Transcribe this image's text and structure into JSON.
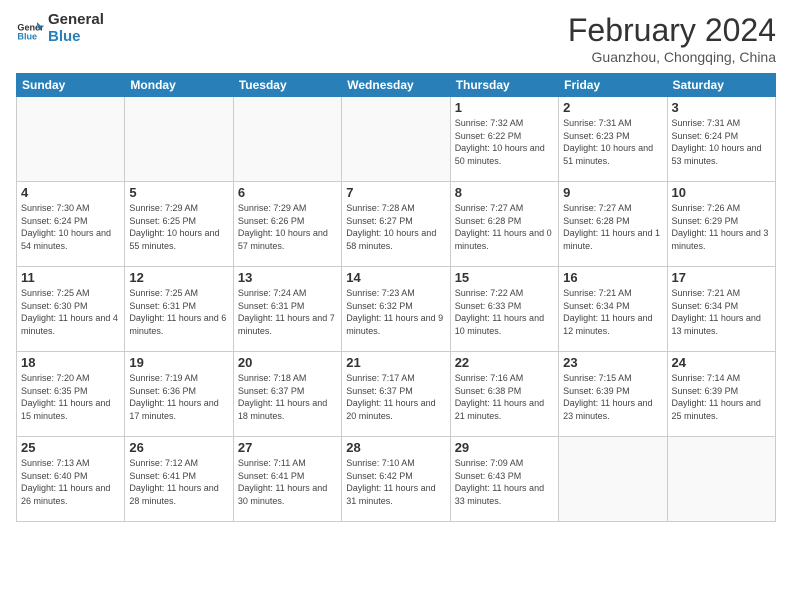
{
  "logo": {
    "line1": "General",
    "line2": "Blue"
  },
  "title": "February 2024",
  "subtitle": "Guanzhou, Chongqing, China",
  "days_header": [
    "Sunday",
    "Monday",
    "Tuesday",
    "Wednesday",
    "Thursday",
    "Friday",
    "Saturday"
  ],
  "weeks": [
    [
      {
        "num": "",
        "info": ""
      },
      {
        "num": "",
        "info": ""
      },
      {
        "num": "",
        "info": ""
      },
      {
        "num": "",
        "info": ""
      },
      {
        "num": "1",
        "info": "Sunrise: 7:32 AM\nSunset: 6:22 PM\nDaylight: 10 hours\nand 50 minutes."
      },
      {
        "num": "2",
        "info": "Sunrise: 7:31 AM\nSunset: 6:23 PM\nDaylight: 10 hours\nand 51 minutes."
      },
      {
        "num": "3",
        "info": "Sunrise: 7:31 AM\nSunset: 6:24 PM\nDaylight: 10 hours\nand 53 minutes."
      }
    ],
    [
      {
        "num": "4",
        "info": "Sunrise: 7:30 AM\nSunset: 6:24 PM\nDaylight: 10 hours\nand 54 minutes."
      },
      {
        "num": "5",
        "info": "Sunrise: 7:29 AM\nSunset: 6:25 PM\nDaylight: 10 hours\nand 55 minutes."
      },
      {
        "num": "6",
        "info": "Sunrise: 7:29 AM\nSunset: 6:26 PM\nDaylight: 10 hours\nand 57 minutes."
      },
      {
        "num": "7",
        "info": "Sunrise: 7:28 AM\nSunset: 6:27 PM\nDaylight: 10 hours\nand 58 minutes."
      },
      {
        "num": "8",
        "info": "Sunrise: 7:27 AM\nSunset: 6:28 PM\nDaylight: 11 hours\nand 0 minutes."
      },
      {
        "num": "9",
        "info": "Sunrise: 7:27 AM\nSunset: 6:28 PM\nDaylight: 11 hours\nand 1 minute."
      },
      {
        "num": "10",
        "info": "Sunrise: 7:26 AM\nSunset: 6:29 PM\nDaylight: 11 hours\nand 3 minutes."
      }
    ],
    [
      {
        "num": "11",
        "info": "Sunrise: 7:25 AM\nSunset: 6:30 PM\nDaylight: 11 hours\nand 4 minutes."
      },
      {
        "num": "12",
        "info": "Sunrise: 7:25 AM\nSunset: 6:31 PM\nDaylight: 11 hours\nand 6 minutes."
      },
      {
        "num": "13",
        "info": "Sunrise: 7:24 AM\nSunset: 6:31 PM\nDaylight: 11 hours\nand 7 minutes."
      },
      {
        "num": "14",
        "info": "Sunrise: 7:23 AM\nSunset: 6:32 PM\nDaylight: 11 hours\nand 9 minutes."
      },
      {
        "num": "15",
        "info": "Sunrise: 7:22 AM\nSunset: 6:33 PM\nDaylight: 11 hours\nand 10 minutes."
      },
      {
        "num": "16",
        "info": "Sunrise: 7:21 AM\nSunset: 6:34 PM\nDaylight: 11 hours\nand 12 minutes."
      },
      {
        "num": "17",
        "info": "Sunrise: 7:21 AM\nSunset: 6:34 PM\nDaylight: 11 hours\nand 13 minutes."
      }
    ],
    [
      {
        "num": "18",
        "info": "Sunrise: 7:20 AM\nSunset: 6:35 PM\nDaylight: 11 hours\nand 15 minutes."
      },
      {
        "num": "19",
        "info": "Sunrise: 7:19 AM\nSunset: 6:36 PM\nDaylight: 11 hours\nand 17 minutes."
      },
      {
        "num": "20",
        "info": "Sunrise: 7:18 AM\nSunset: 6:37 PM\nDaylight: 11 hours\nand 18 minutes."
      },
      {
        "num": "21",
        "info": "Sunrise: 7:17 AM\nSunset: 6:37 PM\nDaylight: 11 hours\nand 20 minutes."
      },
      {
        "num": "22",
        "info": "Sunrise: 7:16 AM\nSunset: 6:38 PM\nDaylight: 11 hours\nand 21 minutes."
      },
      {
        "num": "23",
        "info": "Sunrise: 7:15 AM\nSunset: 6:39 PM\nDaylight: 11 hours\nand 23 minutes."
      },
      {
        "num": "24",
        "info": "Sunrise: 7:14 AM\nSunset: 6:39 PM\nDaylight: 11 hours\nand 25 minutes."
      }
    ],
    [
      {
        "num": "25",
        "info": "Sunrise: 7:13 AM\nSunset: 6:40 PM\nDaylight: 11 hours\nand 26 minutes."
      },
      {
        "num": "26",
        "info": "Sunrise: 7:12 AM\nSunset: 6:41 PM\nDaylight: 11 hours\nand 28 minutes."
      },
      {
        "num": "27",
        "info": "Sunrise: 7:11 AM\nSunset: 6:41 PM\nDaylight: 11 hours\nand 30 minutes."
      },
      {
        "num": "28",
        "info": "Sunrise: 7:10 AM\nSunset: 6:42 PM\nDaylight: 11 hours\nand 31 minutes."
      },
      {
        "num": "29",
        "info": "Sunrise: 7:09 AM\nSunset: 6:43 PM\nDaylight: 11 hours\nand 33 minutes."
      },
      {
        "num": "",
        "info": ""
      },
      {
        "num": "",
        "info": ""
      }
    ]
  ]
}
